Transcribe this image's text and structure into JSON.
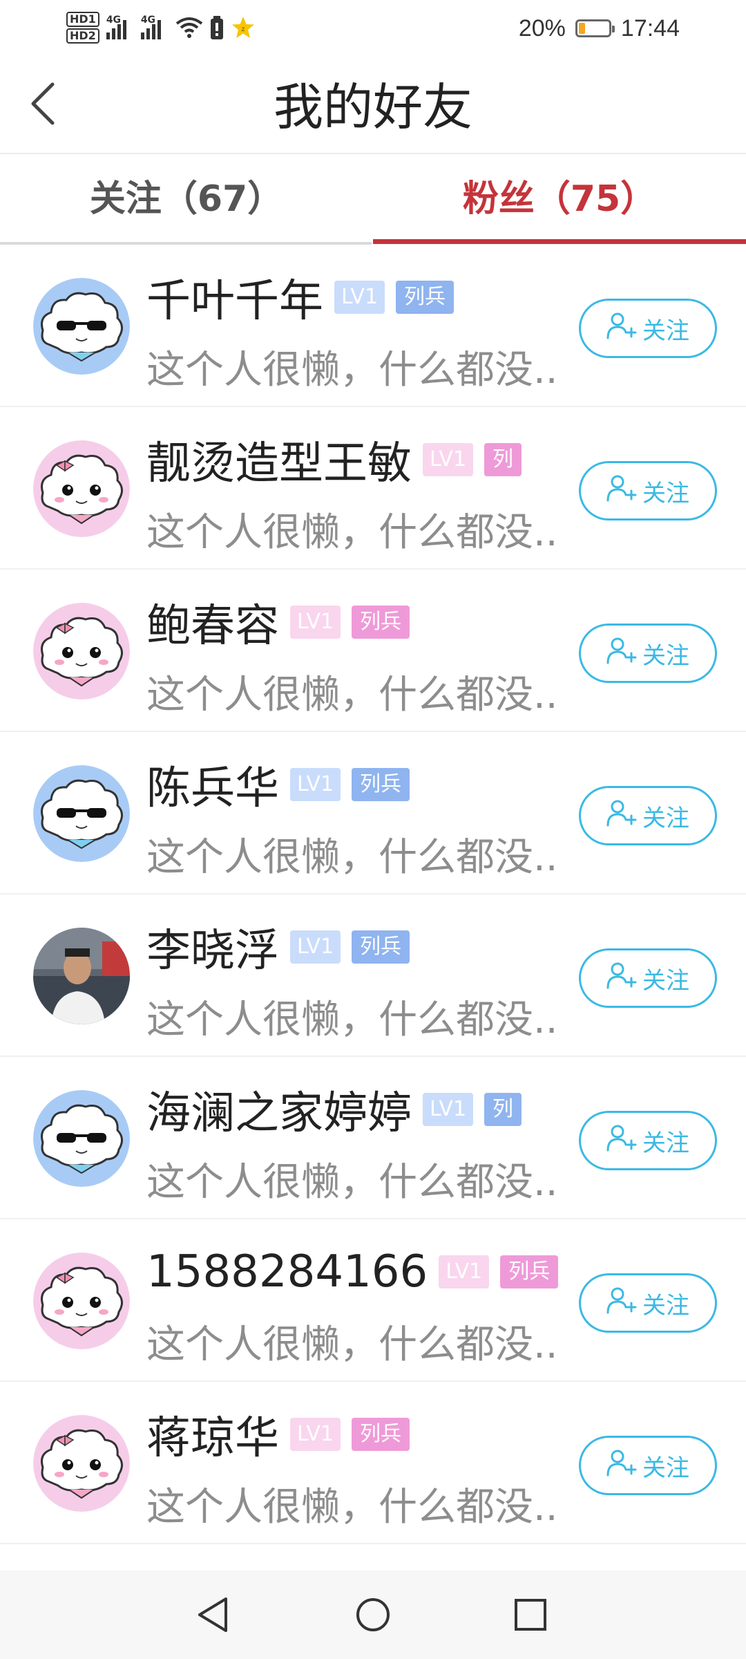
{
  "status_bar": {
    "hd1": "HD1",
    "hd2": "HD2",
    "sim1_network": "4G",
    "sim2_network": "4G",
    "battery_percent": "20%",
    "battery_level": 0.2,
    "time": "17:44",
    "icons": [
      "signal-icon",
      "wifi-icon",
      "battery-saver-icon",
      "star-icon"
    ]
  },
  "header": {
    "back_icon": "back-arrow-icon",
    "title": "我的好友"
  },
  "tabs": [
    {
      "label": "关注（67）",
      "active": false
    },
    {
      "label": "粉丝（75）",
      "active": true
    }
  ],
  "colors": {
    "accent_red": "#c4343a",
    "follow_blue": "#3bb9e4",
    "badge_blue": "#8fb4ef",
    "badge_pink": "#ef9ad8"
  },
  "friends": [
    {
      "name": "千叶千年",
      "level": "LV1",
      "rank": "列兵",
      "bio": "这个人很懒，什么都没...",
      "avatar": "cloud-sunglasses-avatar",
      "theme": "blue",
      "follow_label": "关注"
    },
    {
      "name": "靓烫造型王敏",
      "level": "LV1",
      "rank": "列",
      "bio": "这个人很懒，什么都没...",
      "avatar": "cloud-bow-avatar",
      "theme": "pink",
      "follow_label": "关注"
    },
    {
      "name": "鲍春容",
      "level": "LV1",
      "rank": "列兵",
      "bio": "这个人很懒，什么都没...",
      "avatar": "cloud-bow-avatar",
      "theme": "pink",
      "follow_label": "关注"
    },
    {
      "name": "陈兵华",
      "level": "LV1",
      "rank": "列兵",
      "bio": "这个人很懒，什么都没...",
      "avatar": "cloud-sunglasses-avatar",
      "theme": "blue",
      "follow_label": "关注"
    },
    {
      "name": "李晓浮",
      "level": "LV1",
      "rank": "列兵",
      "bio": "这个人很懒，什么都没...",
      "avatar": "photo-avatar",
      "theme": "blue",
      "follow_label": "关注"
    },
    {
      "name": "海澜之家婷婷",
      "level": "LV1",
      "rank": "列",
      "bio": "这个人很懒，什么都没...",
      "avatar": "cloud-sunglasses-avatar",
      "theme": "blue",
      "follow_label": "关注"
    },
    {
      "name": "1588284166",
      "level": "LV1",
      "rank": "列兵",
      "bio": "这个人很懒，什么都没...",
      "avatar": "cloud-bow-avatar",
      "theme": "pink",
      "follow_label": "关注"
    },
    {
      "name": "蒋琼华",
      "level": "LV1",
      "rank": "列兵",
      "bio": "这个人很懒，什么都没...",
      "avatar": "cloud-bow-avatar",
      "theme": "pink",
      "follow_label": "关注"
    }
  ],
  "nav_bar": {
    "icons": [
      "nav-back-icon",
      "nav-home-icon",
      "nav-recents-icon"
    ]
  }
}
